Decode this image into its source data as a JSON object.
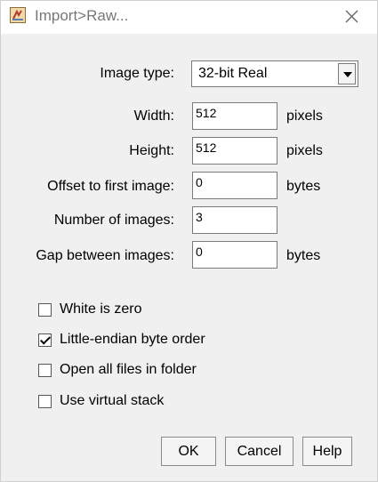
{
  "window": {
    "title": "Import>Raw..."
  },
  "form": {
    "image_type": {
      "label": "Image type:",
      "value": "32-bit Real"
    },
    "width": {
      "label": "Width:",
      "value": "512",
      "unit": "pixels"
    },
    "height": {
      "label": "Height:",
      "value": "512",
      "unit": "pixels"
    },
    "offset": {
      "label": "Offset to first image:",
      "value": "0",
      "unit": "bytes"
    },
    "num_images": {
      "label": "Number of images:",
      "value": "3"
    },
    "gap": {
      "label": "Gap between images:",
      "value": "0",
      "unit": "bytes"
    }
  },
  "checkboxes": [
    {
      "label": "White is zero",
      "checked": false
    },
    {
      "label": "Little-endian byte order",
      "checked": true
    },
    {
      "label": "Open all files in folder",
      "checked": false
    },
    {
      "label": "Use virtual stack",
      "checked": false
    }
  ],
  "buttons": {
    "ok": "OK",
    "cancel": "Cancel",
    "help": "Help"
  }
}
